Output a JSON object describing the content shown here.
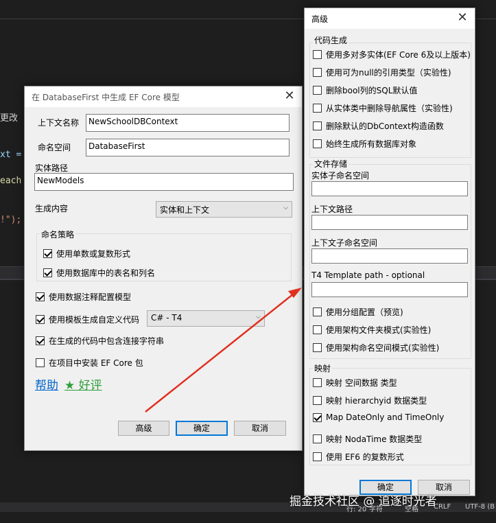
{
  "background_code": {
    "line1": "更改",
    "line2": "xt =",
    "line3": "each",
    "line4": "!\");"
  },
  "status_bar": {
    "line_col": "行: 20",
    "chars": "字符",
    "spaces": "空格",
    "crlf": "CRLF",
    "encoding": "UTF-8 (B"
  },
  "watermark": "掘金技术社区 @ 追逐时光者",
  "main_dialog": {
    "title": "在 DatabaseFirst 中生成 EF Core 模型",
    "context_name_label": "上下文名称",
    "context_name_value": "NewSchoolDBContext",
    "namespace_label": "命名空间",
    "namespace_value": "DatabaseFirst",
    "entity_path_label": "实体路径",
    "entity_path_value": "NewModels",
    "generate_label": "生成内容",
    "generate_value": "实体和上下文",
    "naming_group_title": "命名策略",
    "naming_options": [
      {
        "label": "使用单数或复数形式",
        "checked": true
      },
      {
        "label": "使用数据库中的表名和列名",
        "checked": true
      }
    ],
    "options": [
      {
        "label": "使用数据注释配置模型",
        "checked": true
      },
      {
        "label": "使用模板生成自定义代码",
        "checked": true
      },
      {
        "label": "在生成的代码中包含连接字符串",
        "checked": true
      },
      {
        "label": "在项目中安装 EF Core 包",
        "checked": false
      }
    ],
    "template_value": "C# - T4",
    "help_link": "帮助",
    "rate_link": "★ 好评",
    "advanced_button": "高级",
    "ok_button": "确定",
    "cancel_button": "取消"
  },
  "advanced_dialog": {
    "title": "高级",
    "codegen_group_title": "代码生成",
    "codegen_options": [
      {
        "label": "使用多对多实体(EF Core 6及以上版本)",
        "checked": false
      },
      {
        "label": "使用可为null的引用类型（实验性)",
        "checked": false
      },
      {
        "label": "删除bool列的SQL默认值",
        "checked": false
      },
      {
        "label": "从实体类中删除导航属性（实验性)",
        "checked": false
      },
      {
        "label": "删除默认的DbContext构造函数",
        "checked": false
      },
      {
        "label": "始终生成所有数据库对象",
        "checked": false
      }
    ],
    "file_group_title": "文件存储",
    "entity_sub_ns_label": "实体子命名空间",
    "entity_sub_ns_value": "",
    "context_path_label": "上下文路径",
    "context_path_value": "",
    "context_sub_ns_label": "上下文子命名空间",
    "context_sub_ns_value": "",
    "t4_path_label": "T4 Template path - optional",
    "t4_path_value": "",
    "file_options": [
      {
        "label": "使用分组配置（预览)",
        "checked": false
      },
      {
        "label": "使用架构文件夹模式(实验性)",
        "checked": false
      },
      {
        "label": "使用架构命名空间模式(实验性)",
        "checked": false
      }
    ],
    "mapping_group_title": "映射",
    "mapping_options": [
      {
        "label": "映射 空间数据 类型",
        "checked": false
      },
      {
        "label": "映射 hierarchyid 数据类型",
        "checked": false
      },
      {
        "label": "Map DateOnly and TimeOnly",
        "checked": true
      },
      {
        "label": "映射 NodaTime 数据类型",
        "checked": false
      },
      {
        "label": "使用 EF6 的复数形式",
        "checked": false
      }
    ],
    "ok_button": "确定",
    "cancel_button": "取消"
  },
  "colors": {
    "link_blue": "#0066cc",
    "link_green": "#2e9e3a",
    "arrow_red": "#e03020",
    "default_button_border": "#0078d7"
  }
}
